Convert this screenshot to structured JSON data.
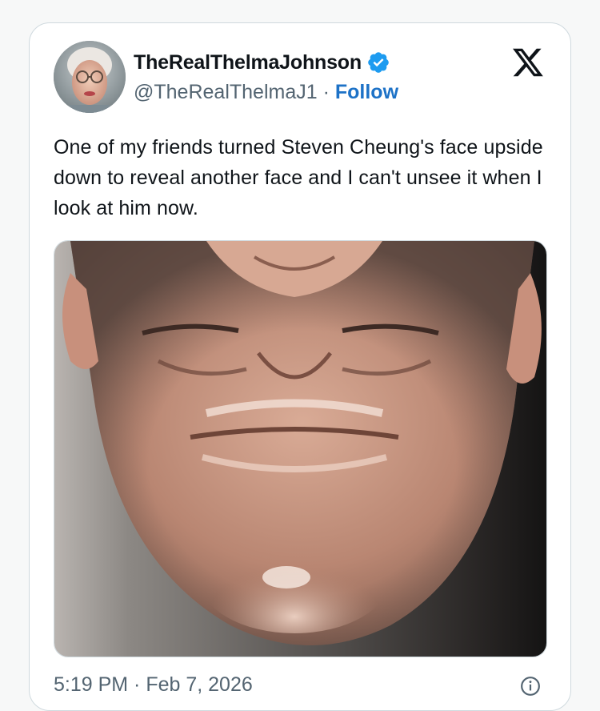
{
  "tweet": {
    "display_name": "TheRealThelmaJohnson",
    "handle": "@TheRealThelmaJ1",
    "separator": " · ",
    "follow_label": "Follow",
    "text": "One of my friends turned Steven Cheung's face upside down to reveal another face and I can't unsee it when I look at him now.",
    "timestamp": "5:19 PM · Feb 7, 2026",
    "verified": true,
    "platform_icon": "x-logo-icon",
    "media_description_icon": "upside-down-face-photo"
  },
  "colors": {
    "accent": "#1d9bf0",
    "follow_link": "#1d72c7",
    "secondary_text": "#536471",
    "border": "#cfd9de"
  }
}
